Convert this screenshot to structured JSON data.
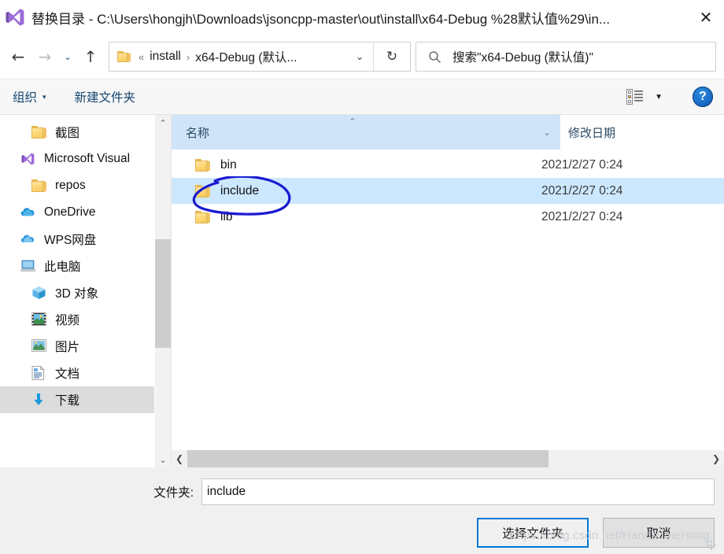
{
  "window": {
    "app_icon": "visual-studio-logo",
    "title": "替换目录 - C:\\Users\\hongjh\\Downloads\\jsoncpp-master\\out\\install\\x64-Debug %28默认值%29\\in...",
    "close_label": "✕"
  },
  "nav": {
    "back_label": "←",
    "forward_label": "→",
    "recent_label": "⌄",
    "up_label": "↑",
    "refresh_label": "↻",
    "dropdown_label": "⌄"
  },
  "breadcrumb": {
    "folder_icon": "folder-icon",
    "overflow": "«",
    "items": [
      {
        "label": "install",
        "sep": "›"
      },
      {
        "label": "x64-Debug (默认...",
        "sep": ""
      }
    ]
  },
  "search": {
    "icon": "search-icon",
    "placeholder": "搜索\"x64-Debug (默认值)\""
  },
  "toolbar": {
    "organize_label": "组织",
    "organize_caret": "▾",
    "new_folder_label": "新建文件夹",
    "view_icon": "view-list-icon",
    "view_caret": "▼",
    "help_label": "?"
  },
  "sidebar": {
    "scroll_up": "⌃",
    "scroll_down": "⌄",
    "items": [
      {
        "label": "截图",
        "icon": "folder-icon",
        "indent": true,
        "selected": false
      },
      {
        "label": "Microsoft Visual",
        "icon": "visual-studio-icon",
        "indent": false,
        "selected": false
      },
      {
        "label": "repos",
        "icon": "folder-icon",
        "indent": true,
        "selected": false
      },
      {
        "label": "OneDrive",
        "icon": "onedrive-cloud-icon",
        "indent": false,
        "selected": false
      },
      {
        "label": "WPS网盘",
        "icon": "wps-cloud-icon",
        "indent": false,
        "selected": false
      },
      {
        "label": "此电脑",
        "icon": "this-pc-icon",
        "indent": false,
        "selected": false
      },
      {
        "label": "3D 对象",
        "icon": "3d-objects-icon",
        "indent": true,
        "selected": false
      },
      {
        "label": "视频",
        "icon": "videos-icon",
        "indent": true,
        "selected": false
      },
      {
        "label": "图片",
        "icon": "pictures-icon",
        "indent": true,
        "selected": false
      },
      {
        "label": "文档",
        "icon": "documents-icon",
        "indent": true,
        "selected": false
      },
      {
        "label": "下载",
        "icon": "downloads-icon",
        "indent": true,
        "selected": true
      }
    ]
  },
  "filelist": {
    "columns": {
      "name": "名称",
      "name_sort": "⌃",
      "name_caret": "⌄",
      "date": "修改日期"
    },
    "rows": [
      {
        "name": "bin",
        "date": "2021/2/27 0:24",
        "icon": "folder-icon",
        "selected": false
      },
      {
        "name": "include",
        "date": "2021/2/27 0:24",
        "icon": "folder-icon",
        "selected": true
      },
      {
        "name": "lib",
        "date": "2021/2/27 0:24",
        "icon": "folder-icon",
        "selected": false
      }
    ],
    "hscroll_left": "❮",
    "hscroll_right": "❯"
  },
  "footer": {
    "folder_label": "文件夹:",
    "folder_value": "include",
    "select_button": "选择文件夹",
    "cancel_button": "取消"
  },
  "annotation": {
    "shape": "hand-drawn-ellipse",
    "color": "#1a1ad0",
    "target": "include"
  },
  "watermark": {
    "text": "https://blog.csdn.net/HandsomeHong"
  }
}
